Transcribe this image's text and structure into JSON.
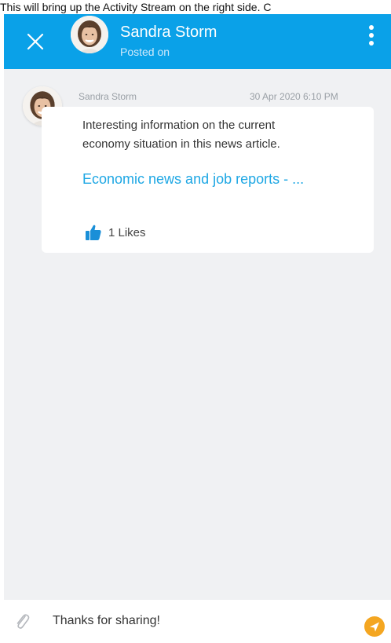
{
  "caption": "This will bring up the Activity Stream on the right side. C",
  "header": {
    "user_name": "Sandra Storm",
    "subtitle": "Posted on"
  },
  "post": {
    "author": "Sandra Storm",
    "timestamp": "30 Apr 2020 6:10 PM",
    "text": "Interesting information on the current economy situation in this news article.",
    "link_text": "Economic news and job reports - ...",
    "likes_label": "1 Likes"
  },
  "composer": {
    "value": "Thanks for sharing!"
  },
  "colors": {
    "header_bg": "#0aa1e8",
    "link": "#1ea7e4",
    "like_icon": "#1a8fd8",
    "send_button": "#f4a621"
  },
  "icons": [
    "close-icon",
    "more-vertical-icon",
    "thumbs-up-icon",
    "attachment-icon",
    "send-icon"
  ]
}
